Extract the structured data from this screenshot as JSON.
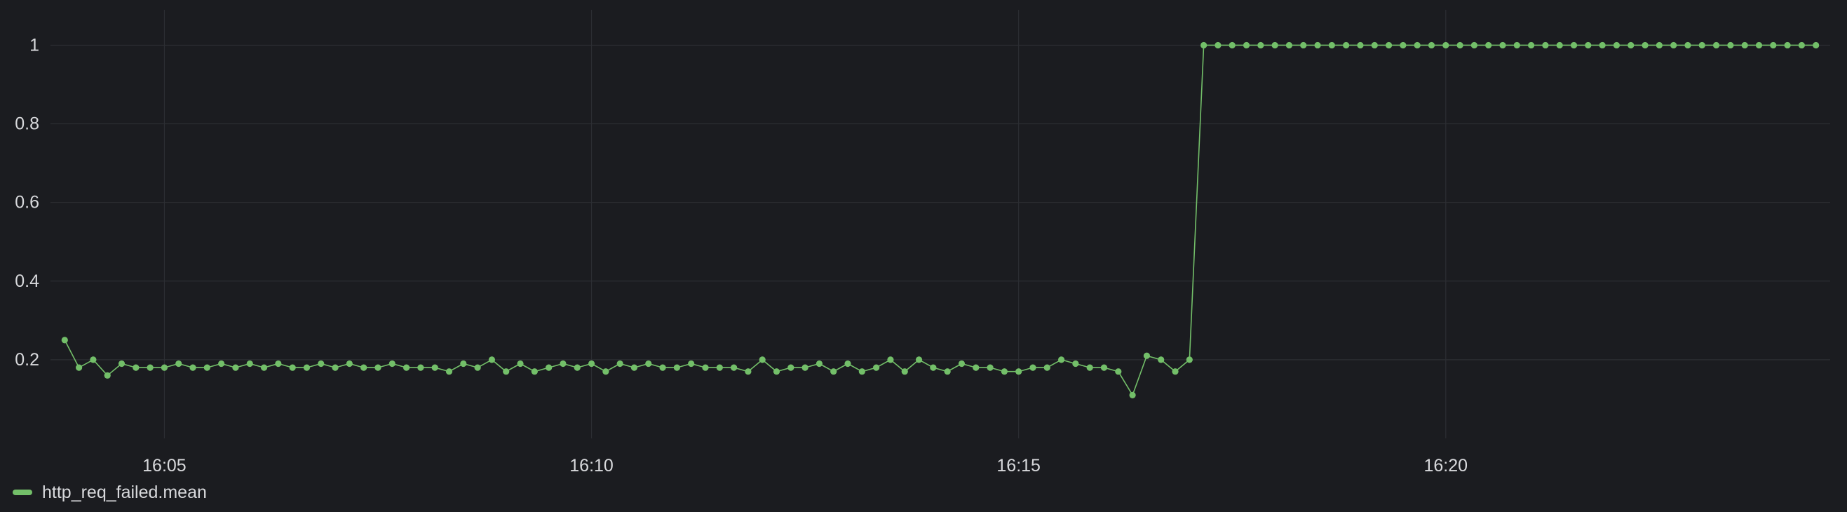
{
  "colors": {
    "background": "#1b1c20",
    "grid": "#2c2e33",
    "tick_text": "#d8d9dc",
    "series": "#73bf69"
  },
  "chart_data": {
    "type": "line",
    "title": "",
    "xlabel": "",
    "ylabel": "",
    "x_tick_labels": [
      "16:05",
      "16:10",
      "16:15",
      "16:20"
    ],
    "x_tick_times": [
      "16:05:00",
      "16:10:00",
      "16:15:00",
      "16:20:00"
    ],
    "y_ticks": [
      0.2,
      0.4,
      0.6,
      0.8,
      1
    ],
    "y_tick_labels": [
      "0.2",
      "0.4",
      "0.6",
      "0.8",
      "1"
    ],
    "xlim": [
      "16:03:40",
      "16:24:30"
    ],
    "ylim": [
      0.0,
      1.09
    ],
    "grid": true,
    "legend_position": "bottom-left",
    "series": [
      {
        "name": "http_req_failed.mean",
        "color": "#73bf69",
        "x": [
          "16:03:50",
          "16:04:00",
          "16:04:10",
          "16:04:20",
          "16:04:30",
          "16:04:40",
          "16:04:50",
          "16:05:00",
          "16:05:10",
          "16:05:20",
          "16:05:30",
          "16:05:40",
          "16:05:50",
          "16:06:00",
          "16:06:10",
          "16:06:20",
          "16:06:30",
          "16:06:40",
          "16:06:50",
          "16:07:00",
          "16:07:10",
          "16:07:20",
          "16:07:30",
          "16:07:40",
          "16:07:50",
          "16:08:00",
          "16:08:10",
          "16:08:20",
          "16:08:30",
          "16:08:40",
          "16:08:50",
          "16:09:00",
          "16:09:10",
          "16:09:20",
          "16:09:30",
          "16:09:40",
          "16:09:50",
          "16:10:00",
          "16:10:10",
          "16:10:20",
          "16:10:30",
          "16:10:40",
          "16:10:50",
          "16:11:00",
          "16:11:10",
          "16:11:20",
          "16:11:30",
          "16:11:40",
          "16:11:50",
          "16:12:00",
          "16:12:10",
          "16:12:20",
          "16:12:30",
          "16:12:40",
          "16:12:50",
          "16:13:00",
          "16:13:10",
          "16:13:20",
          "16:13:30",
          "16:13:40",
          "16:13:50",
          "16:14:00",
          "16:14:10",
          "16:14:20",
          "16:14:30",
          "16:14:40",
          "16:14:50",
          "16:15:00",
          "16:15:10",
          "16:15:20",
          "16:15:30",
          "16:15:40",
          "16:15:50",
          "16:16:00",
          "16:16:10",
          "16:16:20",
          "16:16:30",
          "16:16:40",
          "16:16:50",
          "16:17:00",
          "16:17:10",
          "16:17:20",
          "16:17:30",
          "16:17:40",
          "16:17:50",
          "16:18:00",
          "16:18:10",
          "16:18:20",
          "16:18:30",
          "16:18:40",
          "16:18:50",
          "16:19:00",
          "16:19:10",
          "16:19:20",
          "16:19:30",
          "16:19:40",
          "16:19:50",
          "16:20:00",
          "16:20:10",
          "16:20:20",
          "16:20:30",
          "16:20:40",
          "16:20:50",
          "16:21:00",
          "16:21:10",
          "16:21:20",
          "16:21:30",
          "16:21:40",
          "16:21:50",
          "16:22:00",
          "16:22:10",
          "16:22:20",
          "16:22:30",
          "16:22:40",
          "16:22:50",
          "16:23:00",
          "16:23:10",
          "16:23:20",
          "16:23:30",
          "16:23:40",
          "16:23:50",
          "16:24:00",
          "16:24:10",
          "16:24:20"
        ],
        "values": [
          0.25,
          0.18,
          0.2,
          0.16,
          0.19,
          0.18,
          0.18,
          0.18,
          0.19,
          0.18,
          0.18,
          0.19,
          0.18,
          0.19,
          0.18,
          0.19,
          0.18,
          0.18,
          0.19,
          0.18,
          0.19,
          0.18,
          0.18,
          0.19,
          0.18,
          0.18,
          0.18,
          0.17,
          0.19,
          0.18,
          0.2,
          0.17,
          0.19,
          0.17,
          0.18,
          0.19,
          0.18,
          0.19,
          0.17,
          0.19,
          0.18,
          0.19,
          0.18,
          0.18,
          0.19,
          0.18,
          0.18,
          0.18,
          0.17,
          0.2,
          0.17,
          0.18,
          0.18,
          0.19,
          0.17,
          0.19,
          0.17,
          0.18,
          0.2,
          0.17,
          0.2,
          0.18,
          0.17,
          0.19,
          0.18,
          0.18,
          0.17,
          0.17,
          0.18,
          0.18,
          0.2,
          0.19,
          0.18,
          0.18,
          0.17,
          0.11,
          0.21,
          0.2,
          0.17,
          0.2,
          1,
          1,
          1,
          1,
          1,
          1,
          1,
          1,
          1,
          1,
          1,
          1,
          1,
          1,
          1,
          1,
          1,
          1,
          1,
          1,
          1,
          1,
          1,
          1,
          1,
          1,
          1,
          1,
          1,
          1,
          1,
          1,
          1,
          1,
          1,
          1,
          1,
          1,
          1,
          1,
          1,
          1,
          1,
          1
        ]
      }
    ]
  }
}
